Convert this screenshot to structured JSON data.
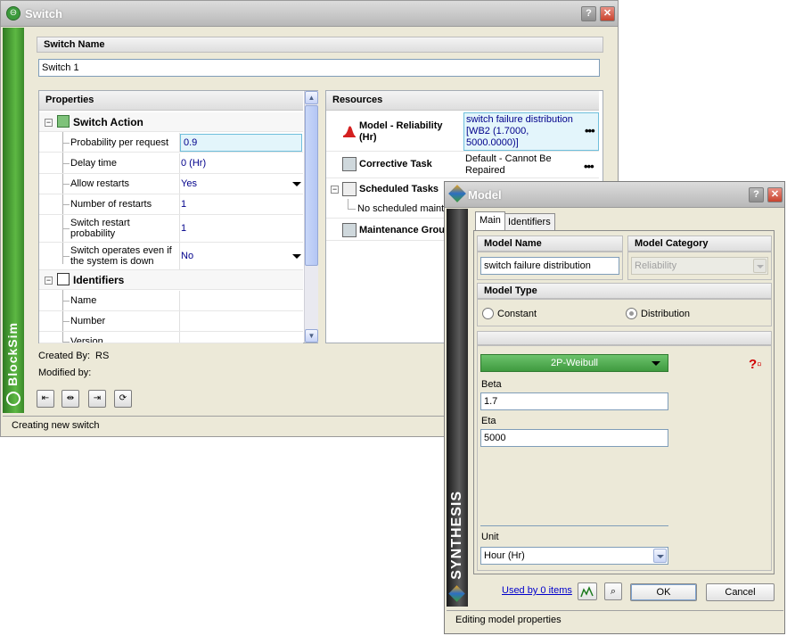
{
  "switch_window": {
    "title": "Switch",
    "sidebar_brand": "BlockSim",
    "switch_name_label": "Switch Name",
    "switch_name_value": "Switch 1",
    "properties": {
      "header": "Properties",
      "category_switch_action": "Switch Action",
      "rows": [
        {
          "label": "Probability per request",
          "value": "0.9"
        },
        {
          "label": "Delay time",
          "value": "0 (Hr)"
        },
        {
          "label": "Allow restarts",
          "value": "Yes"
        },
        {
          "label": "Number of restarts",
          "value": "1"
        },
        {
          "label": "Switch restart probability",
          "value": "1"
        },
        {
          "label": "Switch operates even if the system is down",
          "value": "No"
        }
      ],
      "category_identifiers": "Identifiers",
      "identifier_rows": [
        {
          "label": "Name",
          "value": ""
        },
        {
          "label": "Number",
          "value": ""
        },
        {
          "label": "Version",
          "value": ""
        }
      ]
    },
    "resources": {
      "header": "Resources",
      "model_reliability_label": "Model - Reliability (Hr)",
      "model_reliability_value": "switch failure distribution [WB2 (1.7000, 5000.0000)]",
      "corrective_task_label": "Corrective Task",
      "corrective_task_value": "Default - Cannot Be Repaired",
      "scheduled_tasks_label": "Scheduled Tasks",
      "scheduled_tasks_child": "No scheduled maintenance",
      "maintenance_group_label": "Maintenance Group"
    },
    "created_by_label": "Created By:",
    "created_by_value": "RS",
    "modified_by_label": "Modified by:",
    "status_text": "Creating new switch"
  },
  "model_window": {
    "title": "Model",
    "sidebar_brand": "SYNTHESIS",
    "tabs": [
      "Main",
      "Identifiers"
    ],
    "model_name_label": "Model Name",
    "model_name_value": "switch failure distribution",
    "model_category_label": "Model Category",
    "model_category_value": "Reliability",
    "model_type_label": "Model Type",
    "radio_constant": "Constant",
    "radio_distribution": "Distribution",
    "selected_model_type": "Distribution",
    "distribution_value": "2P-Weibull",
    "beta_label": "Beta",
    "beta_value": "1.7",
    "eta_label": "Eta",
    "eta_value": "5000",
    "unit_label": "Unit",
    "unit_value": "Hour (Hr)",
    "used_by_link": "Used by 0 items",
    "ok_label": "OK",
    "cancel_label": "Cancel",
    "status_text": "Editing model properties"
  },
  "colors": {
    "brand_green": "#4a9b33",
    "value_blue": "#00008b",
    "link_blue": "#0000cc",
    "weibull_button": "#3f9a3f"
  }
}
